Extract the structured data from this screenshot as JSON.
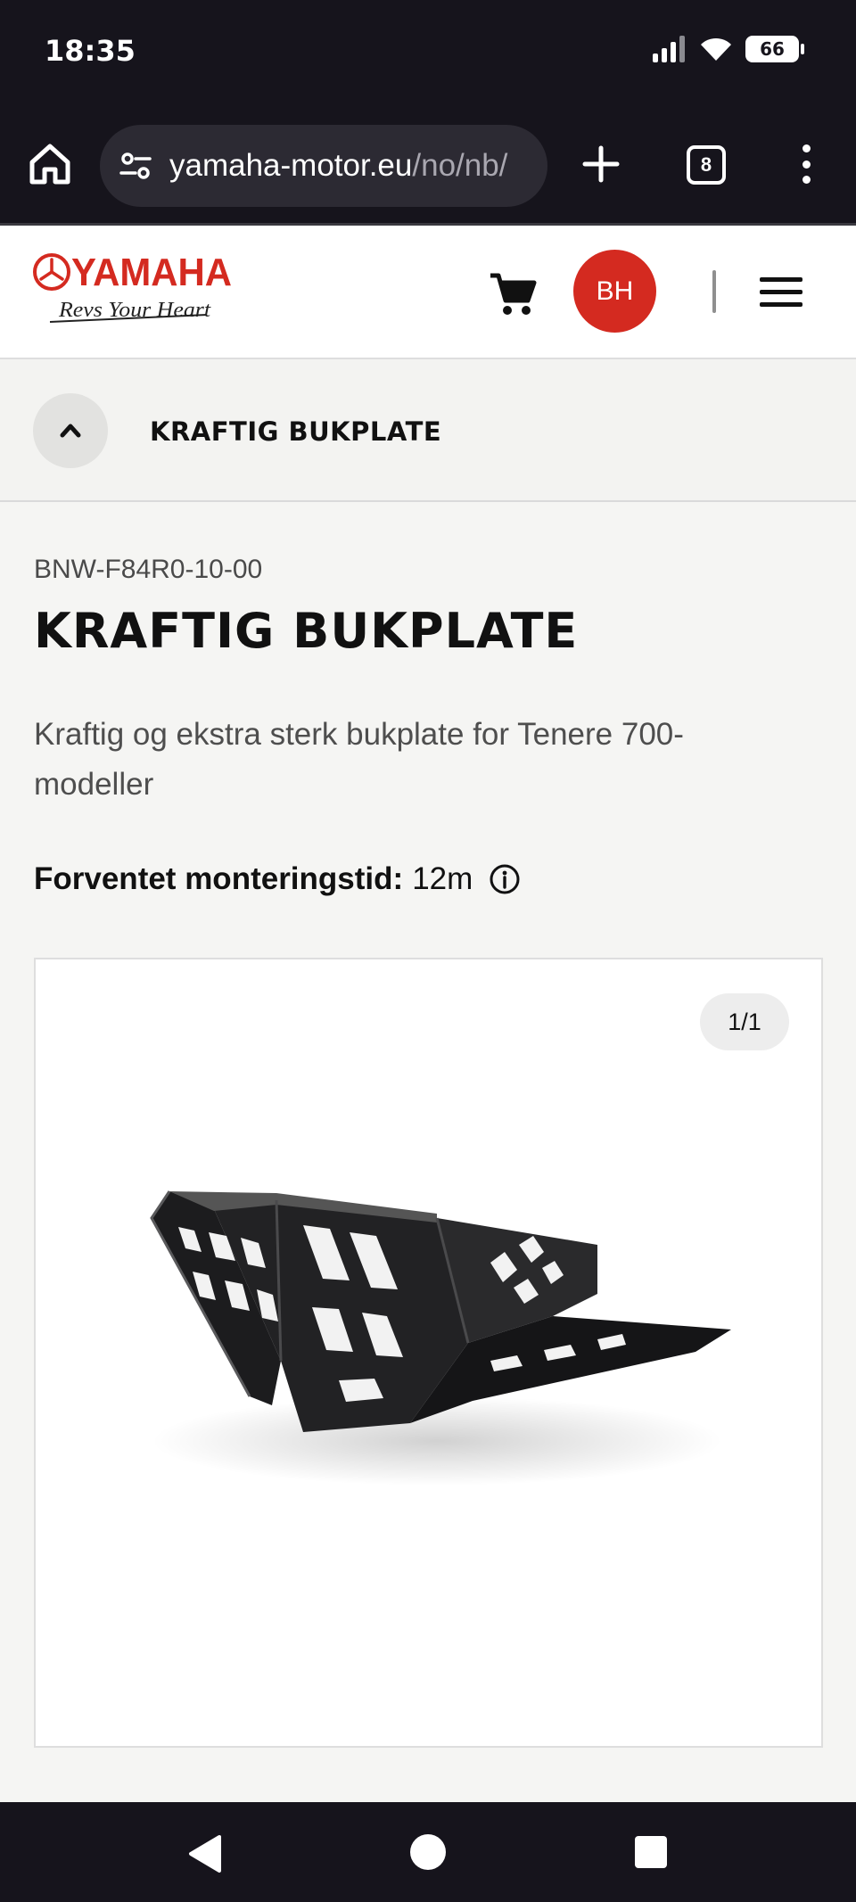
{
  "status_bar": {
    "time": "18:35",
    "battery": "66",
    "icons": [
      "signal-icon",
      "wifi-icon",
      "battery-icon"
    ]
  },
  "browser": {
    "url_domain": "yamaha-motor.eu",
    "url_path": "/no/nb/",
    "tab_count": "8",
    "icons": [
      "home-icon",
      "tune-icon",
      "plus-icon",
      "tabs-icon",
      "kebab-menu-icon"
    ]
  },
  "header": {
    "logo_text": "YAMAHA",
    "logo_tagline": "Revs Your Heart",
    "avatar_initials": "BH",
    "icons": [
      "cart-icon",
      "hamburger-menu-icon"
    ],
    "brand_color": "#d42a20"
  },
  "section_bar": {
    "title": "KRAFTIG BUKPLATE",
    "icon": "chevron-up-icon"
  },
  "product": {
    "sku": "BNW-F84R0-10-00",
    "title": "KRAFTIG BUKPLATE",
    "description": "Kraftig og ekstra sterk bukplate for Tenere 700-modeller",
    "mount_label": "Forventet monteringstid:",
    "mount_value": "12m",
    "info_icon": "info-icon"
  },
  "gallery": {
    "counter": "1/1"
  },
  "nav_bar": {
    "icons": [
      "back-icon",
      "home-circle-icon",
      "recents-icon"
    ]
  }
}
